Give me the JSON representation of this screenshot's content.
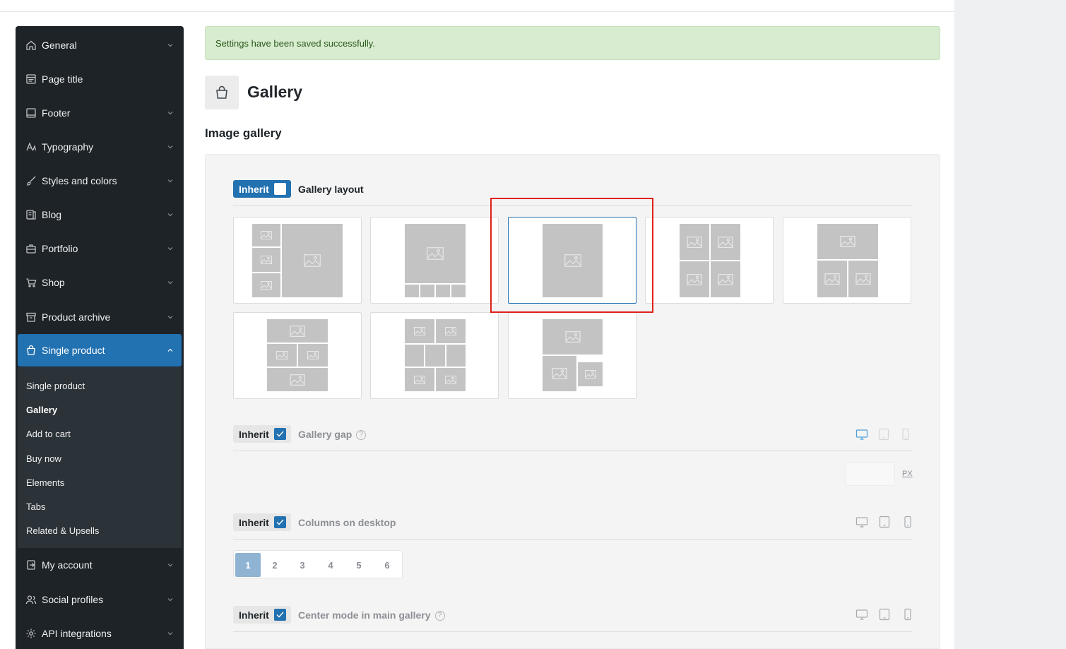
{
  "sidebar": {
    "items": [
      {
        "label": "General",
        "icon": "home-icon"
      },
      {
        "label": "Page title",
        "icon": "page-title-icon"
      },
      {
        "label": "Footer",
        "icon": "footer-icon"
      },
      {
        "label": "Typography",
        "icon": "typography-icon"
      },
      {
        "label": "Styles and colors",
        "icon": "brush-icon"
      },
      {
        "label": "Blog",
        "icon": "blog-icon"
      },
      {
        "label": "Portfolio",
        "icon": "briefcase-icon"
      },
      {
        "label": "Shop",
        "icon": "cart-icon"
      },
      {
        "label": "Product archive",
        "icon": "archive-icon"
      },
      {
        "label": "Single product",
        "icon": "bag-icon"
      },
      {
        "label": "My account",
        "icon": "account-icon"
      },
      {
        "label": "Social profiles",
        "icon": "users-icon"
      },
      {
        "label": "API integrations",
        "icon": "gear-icon"
      }
    ],
    "submenu": [
      {
        "label": "Single product"
      },
      {
        "label": "Gallery"
      },
      {
        "label": "Add to cart"
      },
      {
        "label": "Buy now"
      },
      {
        "label": "Elements"
      },
      {
        "label": "Tabs"
      },
      {
        "label": "Related & Upsells"
      }
    ]
  },
  "notice": {
    "text": "Settings have been saved successfully."
  },
  "page": {
    "title": "Gallery",
    "section_title": "Image gallery"
  },
  "fields": {
    "inherit_label": "Inherit",
    "gallery_layout": "Gallery layout",
    "gallery_gap": "Gallery gap",
    "gallery_gap_value": "",
    "gap_unit": "PX",
    "columns_desktop": "Columns on desktop",
    "columns_options": [
      "1",
      "2",
      "3",
      "4",
      "5",
      "6"
    ],
    "columns_selected": "1",
    "center_mode": "Center mode in main gallery",
    "help_glyph": "?"
  },
  "colors": {
    "accent": "#2271b1",
    "sidebar_bg": "#1d2327",
    "notice_bg": "#d8ecd0",
    "highlight": "#e0201b"
  }
}
